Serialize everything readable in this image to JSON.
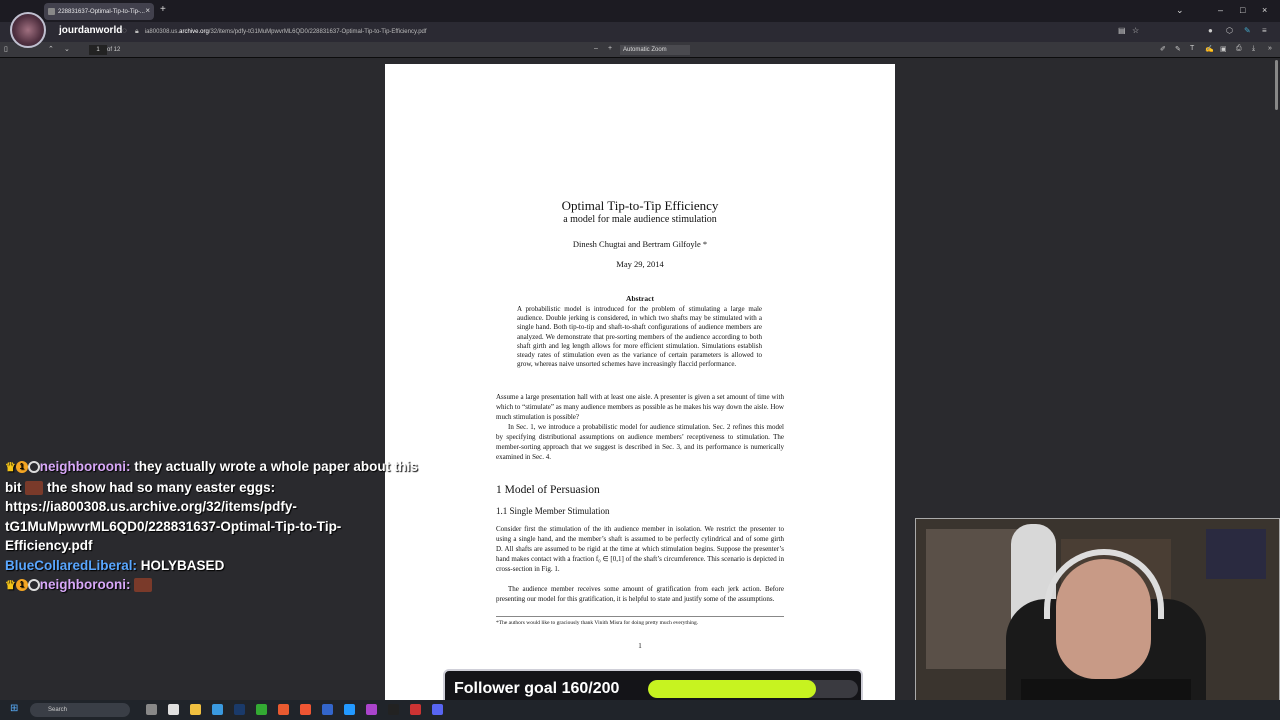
{
  "browser": {
    "tab_title": "228831637-Optimal-Tip-to-Tip-...",
    "url_prefix": "ia800308.us.",
    "url_host": "archive.org",
    "url_path": "/32/items/pdfy-tG1MuMpwvrML6QD0/228831637-Optimal-Tip-to-Tip-Efficiency.pdf"
  },
  "pdf_toolbar": {
    "page_number": "1",
    "page_of": "of 12",
    "zoom": "Automatic Zoom"
  },
  "paper": {
    "title": "Optimal Tip-to-Tip Efficiency",
    "subtitle": "a model for male audience stimulation",
    "authors": "Dinesh Chugtai and Bertram Gilfoyle *",
    "date": "May 29, 2014",
    "abstract_heading": "Abstract",
    "abstract": "A probabilistic model is introduced for the problem of stimulating a large male audience. Double jerking is considered, in which two shafts may be stimulated with a single hand. Both tip-to-tip and shaft-to-shaft configurations of audience members are analyzed. We demonstrate that pre-sorting members of the audience according to both shaft girth and leg length allows for more efficient stimulation. Simulations establish steady rates of stimulation even as the variance of certain parameters is allowed to grow, whereas naive unsorted schemes have increasingly flaccid performance.",
    "intro_p1": "Assume a large presentation hall with at least one aisle. A presenter is given a set amount of time with which to “stimulate” as many audience members as possible as he makes his way down the aisle. How much stimulation is possible?",
    "intro_p2": "In Sec. 1, we introduce a probabilistic model for audience stimulation. Sec. 2 refines this model by specifying distributional assumptions on audience members’ receptiveness to stimulation. The member-sorting approach that we suggest is described in Sec. 3, and its performance is numerically examined in Sec. 4.",
    "section1": "1   Model of Persuasion",
    "subsection11": "1.1   Single Member Stimulation",
    "body_p1": "Consider first the stimulation of the ith audience member in isolation. We restrict the presenter to using a single hand, and the member’s shaft is assumed to be perfectly cylindrical and of some girth D. All shafts are assumed to be rigid at the time at which stimulation begins. Suppose the presenter’s hand makes contact with a fraction f₀ ∈ [0,1] of the shaft’s circumference. This scenario is depicted in cross-section in Fig. 1.",
    "body_p2": "The audience member receives some amount of gratification from each jerk action. Before presenting our model for this gratification, it is helpful to state and justify some of the assumptions.",
    "footnote": "*The authors would like to graciously thank Vinith Misra for doing pretty much everything.",
    "page_number": "1"
  },
  "stream": {
    "channel_name": "jourdanworld",
    "chat": [
      {
        "user": "neighborooni:",
        "message_a": "they actually wrote a whole paper about this bit",
        "message_b": "the show had so many easter eggs: https://ia800308.us.archive.org/32/items/pdfy-tG1MuMpwvrML6QD0/228831637-Optimal-Tip-to-Tip-Efficiency.pdf"
      },
      {
        "user": "BlueCollaredLiberal:",
        "message_a": "HOLYBASED"
      },
      {
        "user": "neighborooni:",
        "message_a": ""
      }
    ],
    "goal_label": "Follower goal 160/200",
    "goal_fraction": 0.8
  },
  "taskbar": {
    "search_placeholder": "Search"
  },
  "colors": {
    "goal_fill": "#c7f320",
    "user1": "#d8a8f8",
    "user2": "#5aa7ff"
  }
}
